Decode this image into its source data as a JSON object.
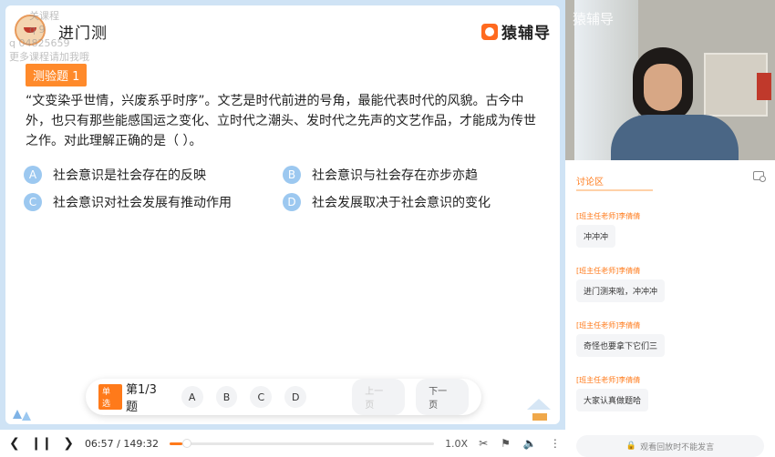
{
  "lesson": {
    "title": "进门测",
    "brand": "猿辅导",
    "watermark": [
      "关课程",
      "q 9",
      "q 04825659",
      "更多课程请加我哦"
    ],
    "quiz_tag": "测验题 1",
    "question": "“文变染乎世情，兴废系乎时序”。文艺是时代前进的号角，最能代表时代的风貌。古今中外，也只有那些能感国运之变化、立时代之潮头、发时代之先声的文艺作品，才能成为传世之作。对此理解正确的是（ ）。",
    "options": [
      {
        "key": "A",
        "text": "社会意识是社会存在的反映"
      },
      {
        "key": "B",
        "text": "社会意识与社会存在亦步亦趋"
      },
      {
        "key": "C",
        "text": "社会意识对社会发展有推动作用"
      },
      {
        "key": "D",
        "text": "社会发展取决于社会意识的变化"
      }
    ],
    "nav": {
      "type": "单选",
      "counter": "第1/3题",
      "choices": [
        "A",
        "B",
        "C",
        "D"
      ],
      "prev": "上一页",
      "next": "下一页"
    }
  },
  "video": {
    "logo": "猿辅导"
  },
  "chat": {
    "title": "讨论区",
    "messages": [
      {
        "sender": "[班主任老师]李倩倩",
        "text": "冲冲冲"
      },
      {
        "sender": "[班主任老师]李倩倩",
        "text": "进门测来啦，冲冲冲"
      },
      {
        "sender": "[班主任老师]李倩倩",
        "text": "奇怪也要拿下它们三"
      },
      {
        "sender": "[班主任老师]李倩倩",
        "text": "大家认真做题哈"
      }
    ],
    "disabled_input": "观看回放时不能发言"
  },
  "player": {
    "current_time": "06:57",
    "separator": "/",
    "total_time": "149:32",
    "progress": 0.047,
    "speed": "1.0X"
  },
  "colors": {
    "accent": "#ff7a1a",
    "option_badge": "#9cc8f0",
    "frame": "#cfe3f5"
  }
}
